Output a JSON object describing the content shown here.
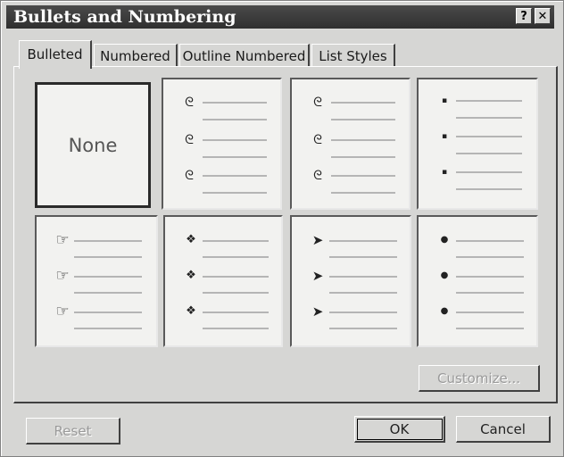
{
  "window": {
    "title": "Bullets and Numbering",
    "help_label": "?",
    "close_label": "✕"
  },
  "tabs": [
    {
      "label": "Bulleted",
      "active": true
    },
    {
      "label": "Numbered",
      "active": false
    },
    {
      "label": "Outline Numbered",
      "active": false
    },
    {
      "label": "List Styles",
      "active": false
    }
  ],
  "gallery": {
    "none_label": "None",
    "styles": [
      {
        "id": "none",
        "selected": true
      },
      {
        "id": "scribble",
        "icon": "scribble-bullet-icon",
        "glyph": "ᘓ"
      },
      {
        "id": "scribble-2",
        "icon": "scribble-bullet-icon",
        "glyph": "ᘓ"
      },
      {
        "id": "small-dot",
        "icon": "small-dot-bullet-icon",
        "glyph": "▪"
      },
      {
        "id": "hand-pointer",
        "icon": "pointing-hand-bullet-icon",
        "glyph": "☞"
      },
      {
        "id": "four-diamond",
        "icon": "four-diamond-bullet-icon",
        "glyph": "❖"
      },
      {
        "id": "arrowhead",
        "icon": "arrowhead-bullet-icon",
        "glyph": "➤"
      },
      {
        "id": "round-dot",
        "icon": "round-dot-bullet-icon",
        "glyph": "●"
      }
    ]
  },
  "buttons": {
    "customize": "Customize...",
    "reset": "Reset",
    "ok": "OK",
    "cancel": "Cancel"
  }
}
